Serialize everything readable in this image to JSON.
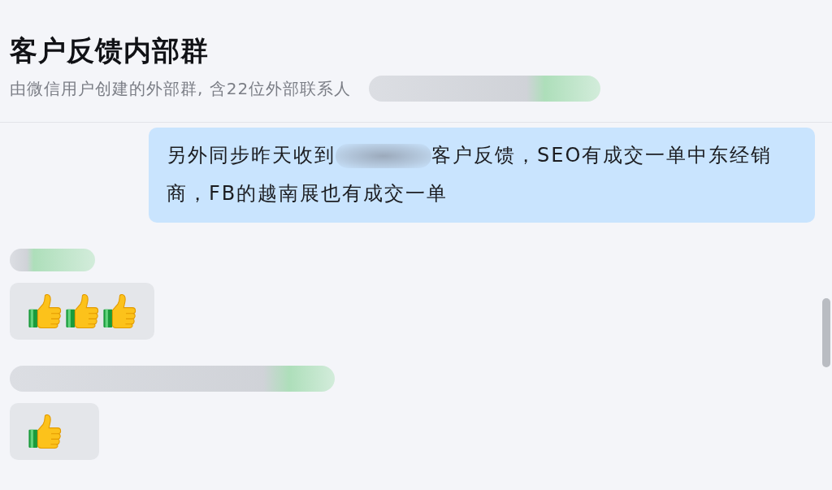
{
  "header": {
    "title": "客户反馈内部群",
    "subtitle": "由微信用户创建的外部群, 含22位外部联系人",
    "subtitle_suffix_redacted": true
  },
  "messages": [
    {
      "kind": "outgoing",
      "segments": [
        {
          "kind": "text",
          "text": "另外同步昨天收到"
        },
        {
          "kind": "redacted"
        },
        {
          "kind": "text",
          "text": "客户反馈，SEO有成交一单中东经销商，FB的越南展也有成交一单"
        }
      ]
    },
    {
      "kind": "incoming",
      "sender_redacted": true,
      "reactions": [
        {
          "kind": "thumbs-up"
        },
        {
          "kind": "thumbs-up"
        },
        {
          "kind": "thumbs-up"
        }
      ]
    },
    {
      "kind": "incoming",
      "sender_redacted": true,
      "reactions": [
        {
          "kind": "thumbs-up"
        }
      ]
    }
  ]
}
